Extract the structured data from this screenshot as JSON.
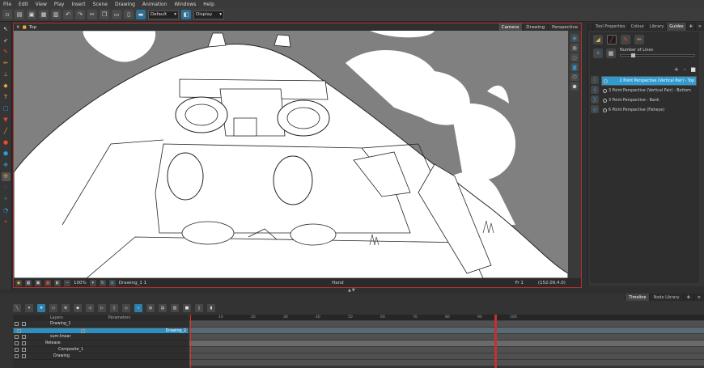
{
  "menu": [
    "File",
    "Edit",
    "View",
    "Play",
    "Insert",
    "Scene",
    "Drawing",
    "Animation",
    "Windows",
    "Help"
  ],
  "toolbar": {
    "preset_select": "Default",
    "mode_select": "Display"
  },
  "camera": {
    "tab_label": "Top",
    "view_tabs": [
      "Camera",
      "Drawing",
      "Perspective"
    ],
    "status": {
      "zoom": "100%",
      "drawing": "Drawing_1 1",
      "tool": "Hand",
      "frame": "Fr 1",
      "coords": "(152.09,4.0)"
    }
  },
  "right_panel": {
    "tabs": [
      "Tool Properties",
      "Colour",
      "Library",
      "Guides"
    ],
    "number_of_lines_label": "Number of Lines",
    "number_of_lines": 0.15,
    "guides": [
      {
        "label": "2 Point Perspective (Vertical Pair) - Top",
        "selected": true
      },
      {
        "label": "3 Point Perspective (Vertical Pair) - Bottom",
        "selected": false
      },
      {
        "label": "3 Point Perspective - Bank",
        "selected": false
      },
      {
        "label": "6 Point Perspective (Fisheye)",
        "selected": false
      }
    ],
    "actions": [
      "+",
      "-",
      "■"
    ]
  },
  "bottom": {
    "tabs": [
      "Timeline",
      "Node Library"
    ],
    "layer_header": {
      "layers": "Layers",
      "params": "Parameters"
    },
    "layers": [
      {
        "name": "Drawing_1",
        "selected": false
      },
      {
        "name": "Drawing_2",
        "selected": true
      },
      {
        "name": "sum-linear",
        "selected": false
      },
      {
        "name": "Release",
        "selected": false
      },
      {
        "name": "Composite_1",
        "selected": false
      },
      {
        "name": "Drawing",
        "selected": false
      }
    ],
    "ruler": [
      "10",
      "20",
      "30",
      "40",
      "50",
      "60",
      "70",
      "80",
      "90",
      "100"
    ]
  },
  "colors": {
    "accent": "#2f9bd0",
    "panel_border": "#b03030",
    "playhead": "#e23030"
  }
}
